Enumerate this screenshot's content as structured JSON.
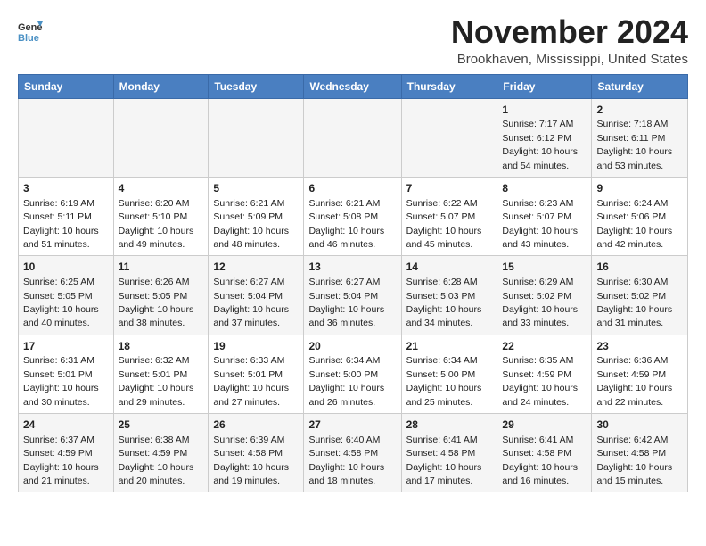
{
  "header": {
    "logo_line1": "General",
    "logo_line2": "Blue",
    "month_title": "November 2024",
    "location": "Brookhaven, Mississippi, United States"
  },
  "weekdays": [
    "Sunday",
    "Monday",
    "Tuesday",
    "Wednesday",
    "Thursday",
    "Friday",
    "Saturday"
  ],
  "weeks": [
    [
      {
        "day": "",
        "info": ""
      },
      {
        "day": "",
        "info": ""
      },
      {
        "day": "",
        "info": ""
      },
      {
        "day": "",
        "info": ""
      },
      {
        "day": "",
        "info": ""
      },
      {
        "day": "1",
        "info": "Sunrise: 7:17 AM\nSunset: 6:12 PM\nDaylight: 10 hours\nand 54 minutes."
      },
      {
        "day": "2",
        "info": "Sunrise: 7:18 AM\nSunset: 6:11 PM\nDaylight: 10 hours\nand 53 minutes."
      }
    ],
    [
      {
        "day": "3",
        "info": "Sunrise: 6:19 AM\nSunset: 5:11 PM\nDaylight: 10 hours\nand 51 minutes."
      },
      {
        "day": "4",
        "info": "Sunrise: 6:20 AM\nSunset: 5:10 PM\nDaylight: 10 hours\nand 49 minutes."
      },
      {
        "day": "5",
        "info": "Sunrise: 6:21 AM\nSunset: 5:09 PM\nDaylight: 10 hours\nand 48 minutes."
      },
      {
        "day": "6",
        "info": "Sunrise: 6:21 AM\nSunset: 5:08 PM\nDaylight: 10 hours\nand 46 minutes."
      },
      {
        "day": "7",
        "info": "Sunrise: 6:22 AM\nSunset: 5:07 PM\nDaylight: 10 hours\nand 45 minutes."
      },
      {
        "day": "8",
        "info": "Sunrise: 6:23 AM\nSunset: 5:07 PM\nDaylight: 10 hours\nand 43 minutes."
      },
      {
        "day": "9",
        "info": "Sunrise: 6:24 AM\nSunset: 5:06 PM\nDaylight: 10 hours\nand 42 minutes."
      }
    ],
    [
      {
        "day": "10",
        "info": "Sunrise: 6:25 AM\nSunset: 5:05 PM\nDaylight: 10 hours\nand 40 minutes."
      },
      {
        "day": "11",
        "info": "Sunrise: 6:26 AM\nSunset: 5:05 PM\nDaylight: 10 hours\nand 38 minutes."
      },
      {
        "day": "12",
        "info": "Sunrise: 6:27 AM\nSunset: 5:04 PM\nDaylight: 10 hours\nand 37 minutes."
      },
      {
        "day": "13",
        "info": "Sunrise: 6:27 AM\nSunset: 5:04 PM\nDaylight: 10 hours\nand 36 minutes."
      },
      {
        "day": "14",
        "info": "Sunrise: 6:28 AM\nSunset: 5:03 PM\nDaylight: 10 hours\nand 34 minutes."
      },
      {
        "day": "15",
        "info": "Sunrise: 6:29 AM\nSunset: 5:02 PM\nDaylight: 10 hours\nand 33 minutes."
      },
      {
        "day": "16",
        "info": "Sunrise: 6:30 AM\nSunset: 5:02 PM\nDaylight: 10 hours\nand 31 minutes."
      }
    ],
    [
      {
        "day": "17",
        "info": "Sunrise: 6:31 AM\nSunset: 5:01 PM\nDaylight: 10 hours\nand 30 minutes."
      },
      {
        "day": "18",
        "info": "Sunrise: 6:32 AM\nSunset: 5:01 PM\nDaylight: 10 hours\nand 29 minutes."
      },
      {
        "day": "19",
        "info": "Sunrise: 6:33 AM\nSunset: 5:01 PM\nDaylight: 10 hours\nand 27 minutes."
      },
      {
        "day": "20",
        "info": "Sunrise: 6:34 AM\nSunset: 5:00 PM\nDaylight: 10 hours\nand 26 minutes."
      },
      {
        "day": "21",
        "info": "Sunrise: 6:34 AM\nSunset: 5:00 PM\nDaylight: 10 hours\nand 25 minutes."
      },
      {
        "day": "22",
        "info": "Sunrise: 6:35 AM\nSunset: 4:59 PM\nDaylight: 10 hours\nand 24 minutes."
      },
      {
        "day": "23",
        "info": "Sunrise: 6:36 AM\nSunset: 4:59 PM\nDaylight: 10 hours\nand 22 minutes."
      }
    ],
    [
      {
        "day": "24",
        "info": "Sunrise: 6:37 AM\nSunset: 4:59 PM\nDaylight: 10 hours\nand 21 minutes."
      },
      {
        "day": "25",
        "info": "Sunrise: 6:38 AM\nSunset: 4:59 PM\nDaylight: 10 hours\nand 20 minutes."
      },
      {
        "day": "26",
        "info": "Sunrise: 6:39 AM\nSunset: 4:58 PM\nDaylight: 10 hours\nand 19 minutes."
      },
      {
        "day": "27",
        "info": "Sunrise: 6:40 AM\nSunset: 4:58 PM\nDaylight: 10 hours\nand 18 minutes."
      },
      {
        "day": "28",
        "info": "Sunrise: 6:41 AM\nSunset: 4:58 PM\nDaylight: 10 hours\nand 17 minutes."
      },
      {
        "day": "29",
        "info": "Sunrise: 6:41 AM\nSunset: 4:58 PM\nDaylight: 10 hours\nand 16 minutes."
      },
      {
        "day": "30",
        "info": "Sunrise: 6:42 AM\nSunset: 4:58 PM\nDaylight: 10 hours\nand 15 minutes."
      }
    ]
  ]
}
